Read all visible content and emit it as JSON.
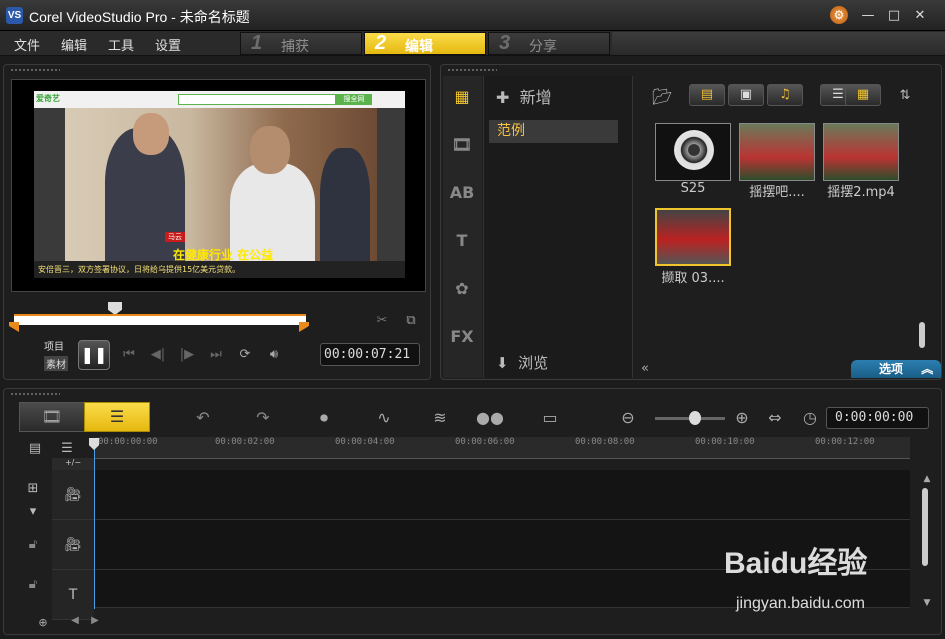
{
  "window": {
    "title": "Corel VideoStudio Pro - 未命名标题",
    "logo": "VS"
  },
  "menu": {
    "file": "文件",
    "edit": "编辑",
    "tools": "工具",
    "settings": "设置"
  },
  "steps": [
    {
      "num": "1",
      "label": "捕获",
      "active": false
    },
    {
      "num": "2",
      "label": "编辑",
      "active": true
    },
    {
      "num": "3",
      "label": "分享",
      "active": false
    }
  ],
  "player": {
    "video": {
      "site": "爱奇艺",
      "search_button": "搜全网",
      "name_tag": "马云",
      "subtitle": "在健康行业 在公益",
      "caption": "安倍晋三，双方签署协议，日将给乌提供15亿美元贷款。"
    },
    "mode_project": "项目",
    "mode_clip": "素材",
    "timecode": "00:00:07:21"
  },
  "library": {
    "add_label": "新增",
    "folder_selected": "范例",
    "browse_label": "浏览",
    "options_label": "选项",
    "items": [
      {
        "label": "S25",
        "type": "audio"
      },
      {
        "label": "揺摆吧....",
        "type": "video"
      },
      {
        "label": "揺摆2.mp4",
        "type": "video"
      },
      {
        "label": "撷取 03....",
        "type": "video",
        "selected": true
      }
    ]
  },
  "timeline": {
    "timecode": "0:00:00:00",
    "ticks": [
      "00:00:00:00",
      "00:00:02:00",
      "00:00:04:00",
      "00:00:06:00",
      "00:00:08:00",
      "00:00:10:00",
      "00:00:12:00"
    ],
    "add_remove": "+/−"
  },
  "watermark": {
    "brand": "Baidu经验",
    "url": "jingyan.baidu.com"
  },
  "colors": {
    "accent": "#f0c52b",
    "timeline_playhead": "#4a9be8",
    "options_tab": "#2c7fb0"
  }
}
